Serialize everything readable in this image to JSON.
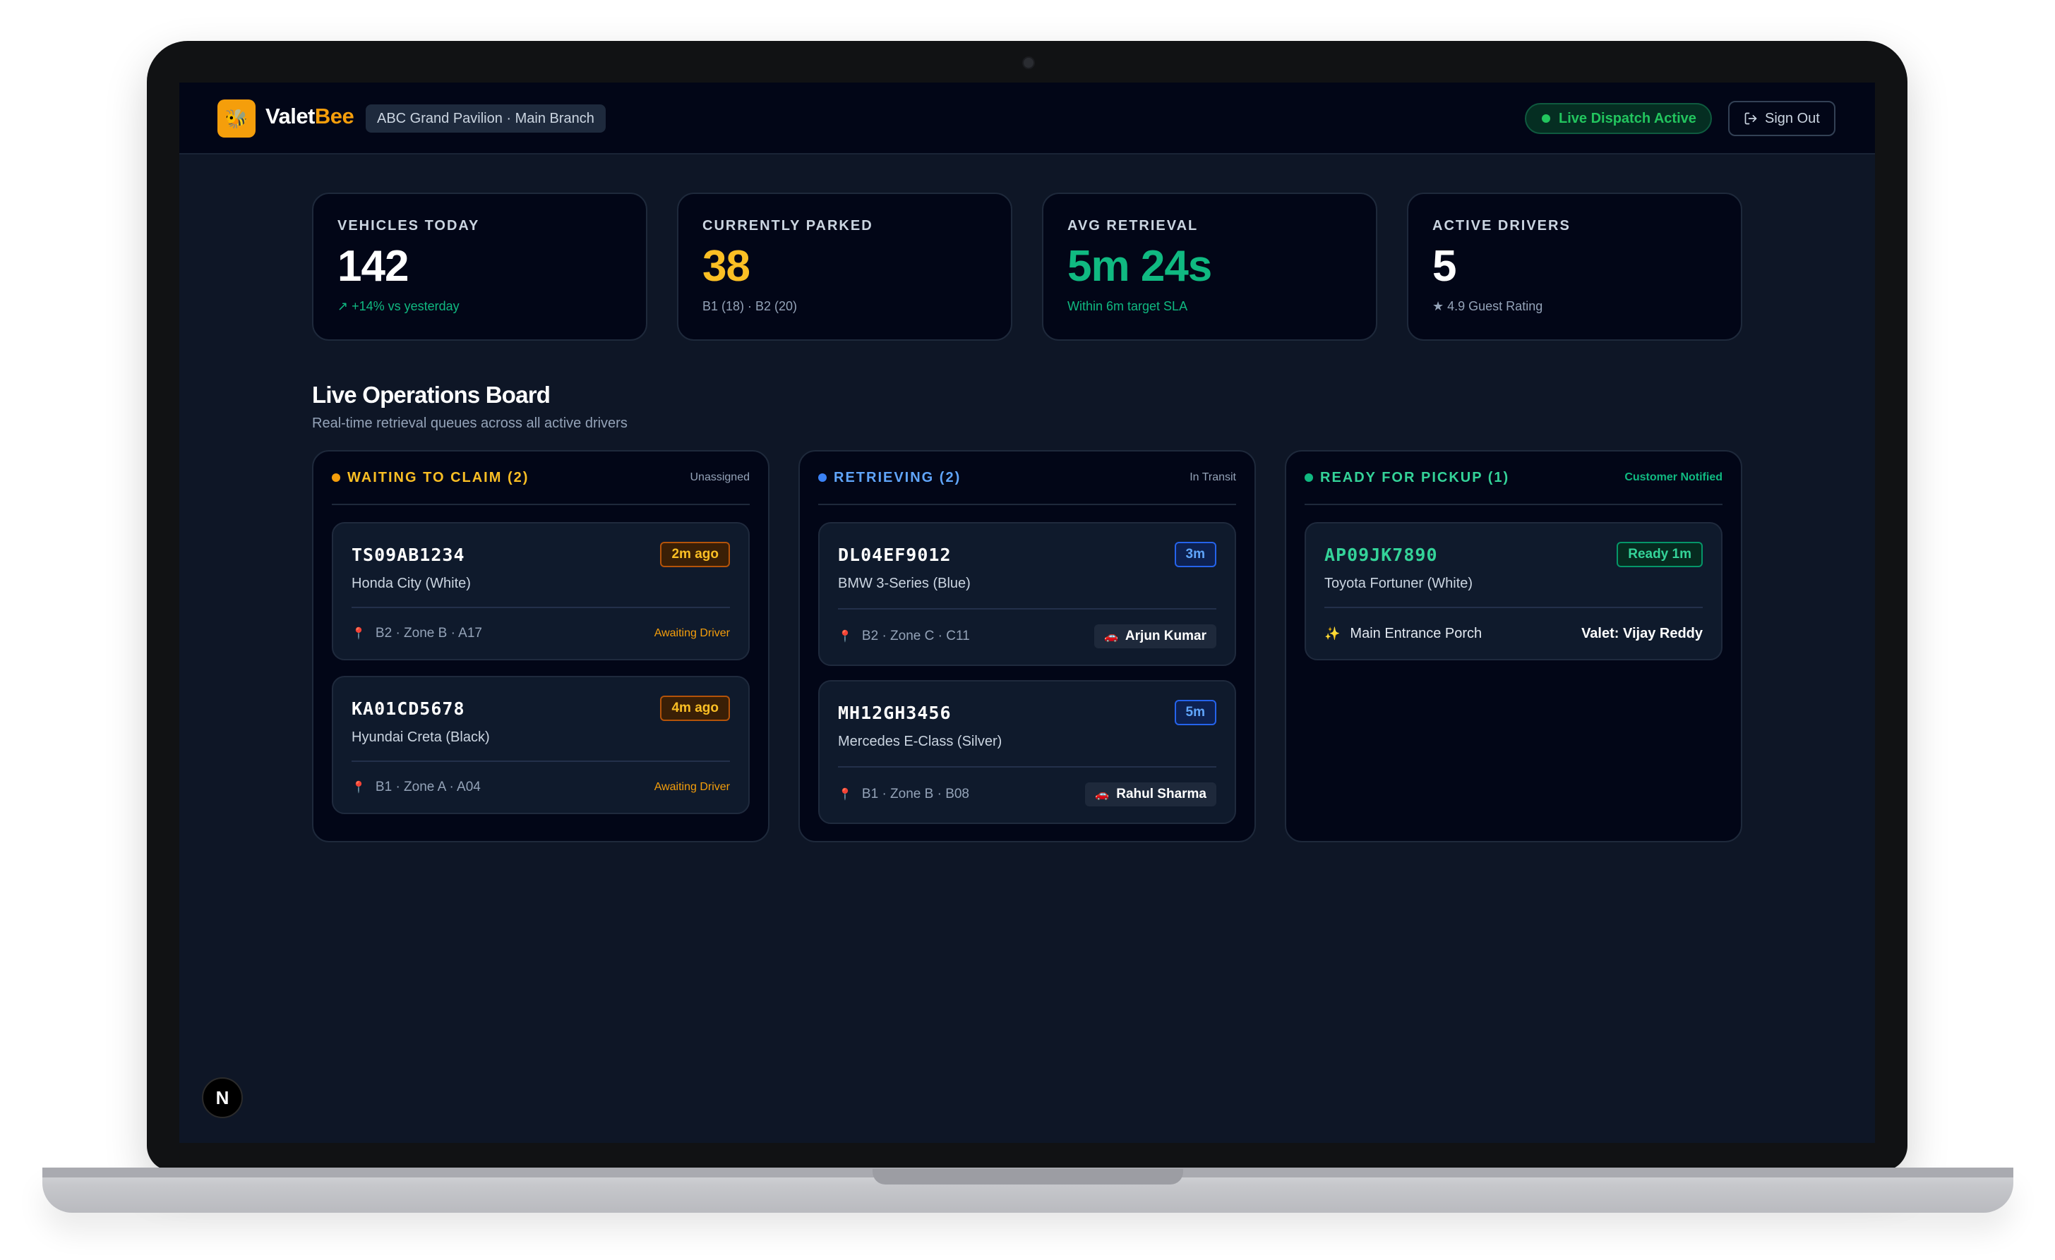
{
  "header": {
    "logo_glyph": "🐝",
    "brand_primary": "Valet",
    "brand_accent": "Bee",
    "branch": "ABC Grand Pavilion · Main Branch",
    "live_status": "Live Dispatch Active",
    "signout_label": "Sign Out"
  },
  "stats": [
    {
      "label": "VEHICLES TODAY",
      "value": "142",
      "sub": "↗  +14% vs yesterday"
    },
    {
      "label": "CURRENTLY PARKED",
      "value": "38",
      "sub": "B1 (18) · B2 (20)"
    },
    {
      "label": "AVG RETRIEVAL",
      "value": "5m 24s",
      "sub": "Within 6m target SLA"
    },
    {
      "label": "ACTIVE DRIVERS",
      "value": "5",
      "sub": "★ 4.9 Guest Rating"
    }
  ],
  "board": {
    "title": "Live Operations Board",
    "subtitle": "Real-time retrieval queues across all active drivers"
  },
  "columns": {
    "waiting": {
      "title": "WAITING TO CLAIM (2)",
      "note": "Unassigned",
      "cards": [
        {
          "plate": "TS09AB1234",
          "model": "Honda City (White)",
          "badge": "2m ago",
          "location": "B2 · Zone B · A17",
          "status": "Awaiting Driver"
        },
        {
          "plate": "KA01CD5678",
          "model": "Hyundai Creta (Black)",
          "badge": "4m ago",
          "location": "B1 · Zone A · A04",
          "status": "Awaiting Driver"
        }
      ]
    },
    "retrieving": {
      "title": "RETRIEVING (2)",
      "note": "In Transit",
      "cards": [
        {
          "plate": "DL04EF9012",
          "model": "BMW 3-Series (Blue)",
          "badge": "3m",
          "location": "B2 · Zone C · C11",
          "driver": "Arjun Kumar"
        },
        {
          "plate": "MH12GH3456",
          "model": "Mercedes E-Class (Silver)",
          "badge": "5m",
          "location": "B1 · Zone B · B08",
          "driver": "Rahul Sharma"
        }
      ]
    },
    "ready": {
      "title": "READY FOR PICKUP (1)",
      "note": "Customer Notified",
      "cards": [
        {
          "plate": "AP09JK7890",
          "model": "Toyota Fortuner (White)",
          "badge": "Ready 1m",
          "location": "Main Entrance Porch",
          "valet": "Valet: Vijay Reddy"
        }
      ]
    }
  },
  "dev_badge": "N",
  "colors": {
    "accent": "#f59e0b",
    "success": "#10b981",
    "info": "#60a5fa",
    "background": "#0e1626",
    "surface": "#020617"
  },
  "icons": {
    "pin": "map-pin-icon",
    "car": "car-icon",
    "sparkle": "sparkle-icon",
    "signout": "sign-out-icon",
    "star": "star-icon",
    "trend": "trend-up-icon"
  }
}
